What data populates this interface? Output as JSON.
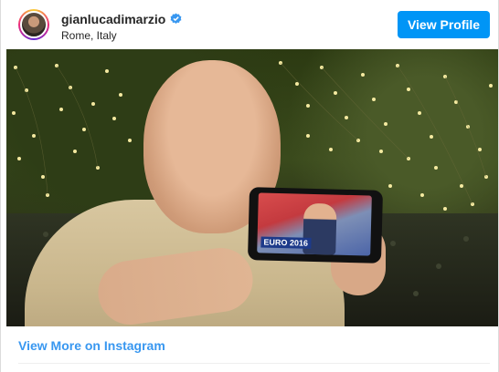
{
  "header": {
    "username": "gianlucadimarzio",
    "location": "Rome, Italy",
    "verified": true,
    "view_profile_label": "View Profile"
  },
  "media": {
    "phone_screen_tag": "EURO 2016"
  },
  "footer": {
    "view_more_label": "View More on Instagram"
  },
  "colors": {
    "accent": "#0095f6",
    "link": "#3897f0",
    "text": "#262626"
  },
  "icons": {
    "verified": "verified-badge-icon"
  }
}
